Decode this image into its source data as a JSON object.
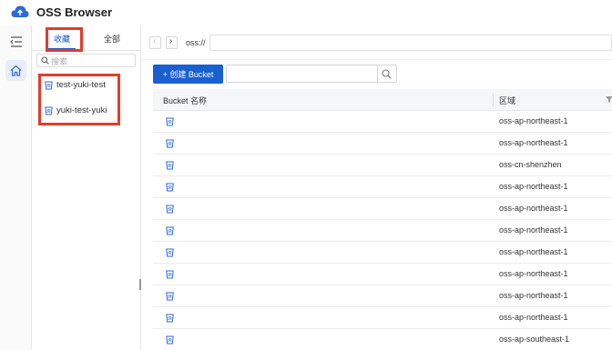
{
  "app": {
    "title": "OSS Browser",
    "accent": "#1a5fd1",
    "annotation_color": "#e03c2d"
  },
  "sidebar_rail": {
    "items": [
      {
        "icon": "menu-icon"
      },
      {
        "icon": "home-icon"
      }
    ]
  },
  "panel": {
    "tabs": [
      {
        "label": "收藏"
      },
      {
        "label": "全部"
      }
    ],
    "search_placeholder": "搜索",
    "favorites": [
      {
        "name": "test-yuki-test"
      },
      {
        "name": "yuki-test-yuki"
      }
    ]
  },
  "topbar": {
    "path_prefix": "oss://",
    "path_value": ""
  },
  "toolbar": {
    "create_label": "+ 创建 Bucket",
    "filter_value": ""
  },
  "table": {
    "columns": [
      "Bucket 名称",
      "区域"
    ],
    "rows": [
      {
        "name": "",
        "region": "oss-ap-northeast-1"
      },
      {
        "name": "",
        "region": "oss-ap-northeast-1"
      },
      {
        "name": "",
        "region": "oss-cn-shenzhen"
      },
      {
        "name": "",
        "region": "oss-ap-northeast-1"
      },
      {
        "name": "",
        "region": "oss-ap-northeast-1"
      },
      {
        "name": "",
        "region": "oss-ap-northeast-1"
      },
      {
        "name": "",
        "region": "oss-ap-northeast-1"
      },
      {
        "name": "",
        "region": "oss-ap-northeast-1"
      },
      {
        "name": "",
        "region": "oss-ap-northeast-1"
      },
      {
        "name": "",
        "region": "oss-ap-northeast-1"
      },
      {
        "name": "",
        "region": "oss-ap-southeast-1"
      }
    ]
  }
}
